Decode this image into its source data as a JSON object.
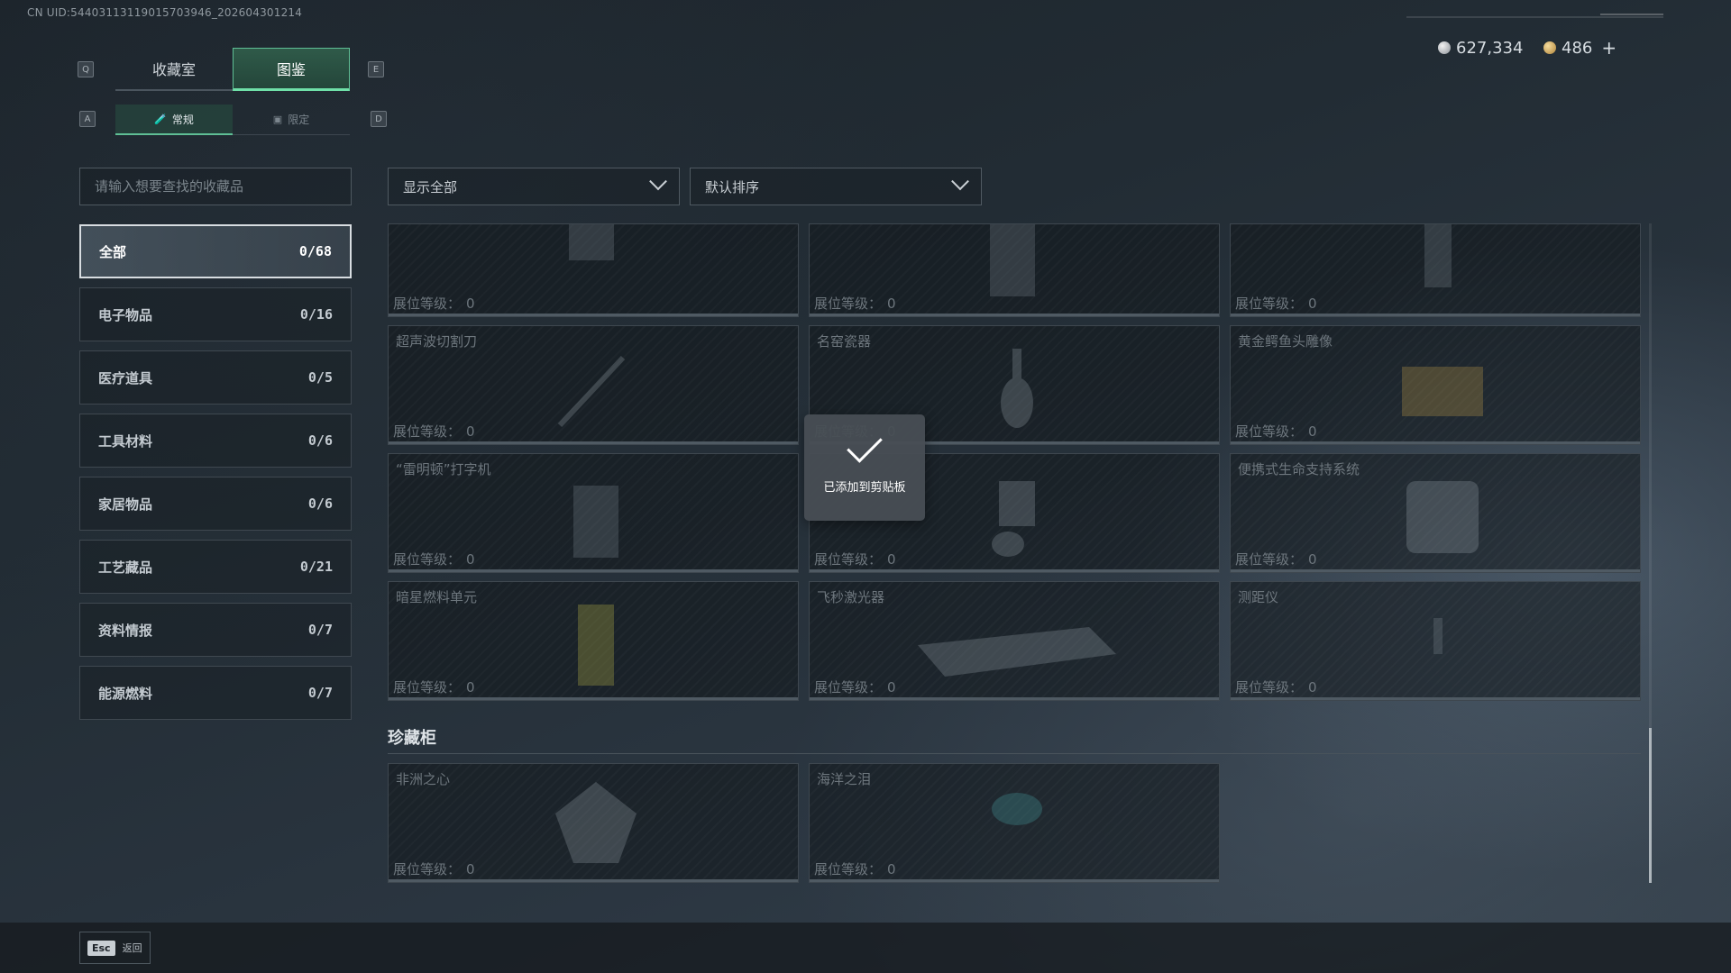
{
  "uid": "CN UID:54403113119015703946_202604301214",
  "currency": {
    "silver_icon": "silver-coin-icon",
    "silver": "627,334",
    "gold_icon": "gold-coin-icon",
    "gold": "486",
    "plus": "+"
  },
  "keys": {
    "q": "Q",
    "e": "E",
    "a": "A",
    "d": "D"
  },
  "main_tabs": [
    {
      "label": "收藏室",
      "active": false
    },
    {
      "label": "图鉴",
      "active": true
    }
  ],
  "sub_tabs": [
    {
      "label": "常规",
      "icon": "flask-icon",
      "active": true
    },
    {
      "label": "限定",
      "icon": "box-icon",
      "active": false
    }
  ],
  "search": {
    "placeholder": "请输入想要查找的收藏品"
  },
  "categories": [
    {
      "label": "全部",
      "count": "0/68"
    },
    {
      "label": "电子物品",
      "count": "0/16"
    },
    {
      "label": "医疗道具",
      "count": "0/5"
    },
    {
      "label": "工具材料",
      "count": "0/6"
    },
    {
      "label": "家居物品",
      "count": "0/6"
    },
    {
      "label": "工艺藏品",
      "count": "0/21"
    },
    {
      "label": "资料情报",
      "count": "0/7"
    },
    {
      "label": "能源燃料",
      "count": "0/7"
    }
  ],
  "filters": {
    "show": "显示全部",
    "sort": "默认排序"
  },
  "level_label": "展位等级：",
  "cards": [
    {
      "name": "",
      "level": "0"
    },
    {
      "name": "",
      "level": "0"
    },
    {
      "name": "",
      "level": "0"
    },
    {
      "name": "超声波切割刀",
      "level": "0"
    },
    {
      "name": "名窑瓷器",
      "level": "0"
    },
    {
      "name": "黄金鳄鱼头雕像",
      "level": "0"
    },
    {
      "name": "“雷明顿”打字机",
      "level": "0"
    },
    {
      "name": "",
      "level": "0"
    },
    {
      "name": "便携式生命支持系统",
      "level": "0"
    },
    {
      "name": "暗星燃料单元",
      "level": "0"
    },
    {
      "name": "飞秒激光器",
      "level": "0"
    },
    {
      "name": "测距仪",
      "level": "0"
    }
  ],
  "section": {
    "title": "珍藏柜",
    "cards": [
      {
        "name": "非洲之心",
        "level": "0"
      },
      {
        "name": "海洋之泪",
        "level": "0"
      }
    ]
  },
  "toast": {
    "icon": "checkmark-icon",
    "message": "已添加到剪贴板"
  },
  "footer": {
    "key": "Esc",
    "label": "返回"
  }
}
